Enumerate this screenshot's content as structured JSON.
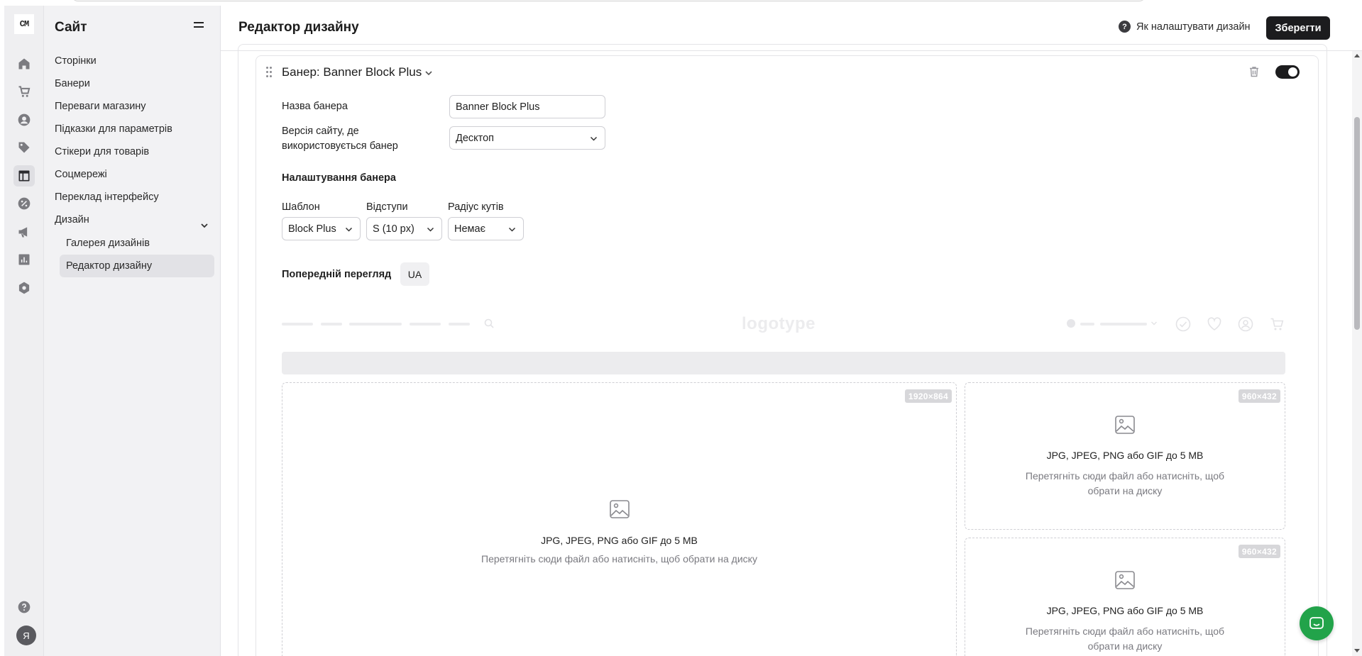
{
  "app": {
    "logo_text": "CM"
  },
  "rail": {
    "items": [
      "home-icon",
      "cart-icon",
      "user-icon",
      "tag-icon",
      "layout-icon",
      "percent-icon",
      "megaphone-icon",
      "chart-icon",
      "settings-icon"
    ],
    "active": "layout-icon",
    "help": "help-icon",
    "avatar_letter": "Я"
  },
  "sidenav": {
    "title": "Сайт",
    "items": [
      {
        "label": "Сторінки"
      },
      {
        "label": "Банери"
      },
      {
        "label": "Переваги магазину"
      },
      {
        "label": "Підказки для параметрів"
      },
      {
        "label": "Стікери для товарів"
      },
      {
        "label": "Соцмережі"
      },
      {
        "label": "Переклад інтерфейсу"
      },
      {
        "label": "Дизайн"
      }
    ],
    "sub_items": [
      {
        "label": "Галерея дизайнів"
      },
      {
        "label": "Редактор дизайну"
      }
    ],
    "active_sub": "Редактор дизайну"
  },
  "header": {
    "title": "Редактор дизайну",
    "help_link": "Як налаштувати дизайн",
    "save_label": "Зберегти"
  },
  "banner": {
    "title": "Банер: Banner Block Plus",
    "enabled": true,
    "name_label": "Назва банера",
    "name_value": "Banner Block Plus",
    "version_label_1": "Версія сайту, де",
    "version_label_2": "використовується банер",
    "version_value": "Десктоп",
    "settings_heading": "Налаштування банера",
    "template_label": "Шаблон",
    "template_value": "Block Plus",
    "padding_label": "Відступи",
    "padding_value": "S (10 px)",
    "radius_label": "Радіус кутів",
    "radius_value": "Немає",
    "preview_label": "Попередній перегляд",
    "preview_lang": "UA"
  },
  "preview": {
    "logo_text": "logotype",
    "slots": [
      {
        "size": "1920×864",
        "formats": "JPG, JPEG, PNG або GIF до 5 MB",
        "hint": "Перетягніть сюди файл або натисніть, щоб обрати на диску"
      },
      {
        "size": "960×432",
        "formats": "JPG, JPEG, PNG або GIF до 5 MB",
        "hint_1": "Перетягніть сюди файл або натисніть, щоб",
        "hint_2": "обрати на диску"
      },
      {
        "size": "960×432",
        "formats": "JPG, JPEG, PNG або GIF до 5 MB",
        "hint_1": "Перетягніть сюди файл або натисніть, щоб",
        "hint_2": "обрати на диску"
      }
    ]
  },
  "colors": {
    "accent": "#1c1c1e",
    "chat": "#22a34a",
    "rail_bg": "#efeff1"
  }
}
